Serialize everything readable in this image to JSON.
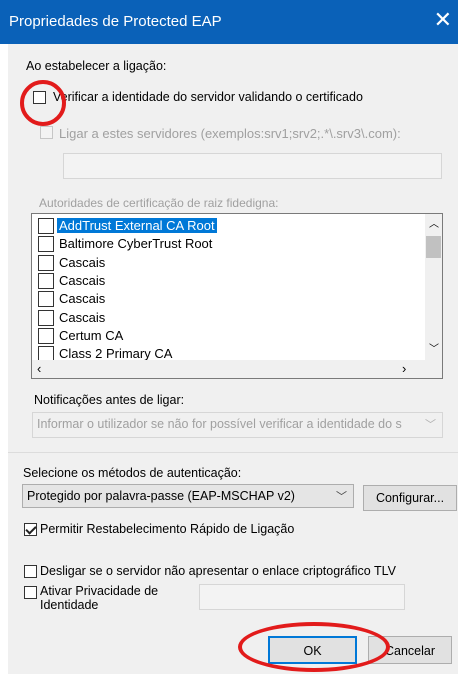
{
  "window": {
    "title": "Propriedades de Protected EAP",
    "close_icon": "close-icon"
  },
  "connect_section": {
    "heading": "Ao estabelecer a ligação:",
    "verify_server_label": "Verificar a identidade do servidor validando o certificado",
    "verify_server_checked": false,
    "connect_servers_label": "Ligar a estes servidores (exemplos:srv1;srv2;.*\\.srv3\\.com):",
    "connect_servers_checked": false,
    "servers_value": ""
  },
  "root_ca": {
    "label": "Autoridades de certificação de raiz fidedigna:",
    "items": [
      {
        "label": "AddTrust External CA Root",
        "checked": false,
        "selected": true
      },
      {
        "label": "Baltimore CyberTrust Root",
        "checked": false,
        "selected": false
      },
      {
        "label": "Cascais",
        "checked": false,
        "selected": false
      },
      {
        "label": "Cascais",
        "checked": false,
        "selected": false
      },
      {
        "label": "Cascais",
        "checked": false,
        "selected": false
      },
      {
        "label": "Cascais",
        "checked": false,
        "selected": false
      },
      {
        "label": "Certum CA",
        "checked": false,
        "selected": false
      },
      {
        "label": "Class 2 Primary CA",
        "checked": false,
        "selected": false
      }
    ]
  },
  "notifications": {
    "label": "Notificações antes de ligar:",
    "selected": "Informar o utilizador se não for possível verificar a identidade do s"
  },
  "auth": {
    "label": "Selecione os métodos de autenticação:",
    "method": "Protegido por palavra-passe (EAP-MSCHAP v2)",
    "configure_label": "Configurar...",
    "fast_reconnect_label": "Permitir Restabelecimento Rápido de Ligação",
    "fast_reconnect_checked": true,
    "disconnect_tlv_label": "Desligar se o servidor não apresentar o enlace criptográfico TLV",
    "disconnect_tlv_checked": false,
    "privacy_label": "Ativar Privacidade de Identidade",
    "privacy_checked": false,
    "privacy_value": ""
  },
  "buttons": {
    "ok": "OK",
    "cancel": "Cancelar"
  },
  "annotation_color": "#e21b1b",
  "accent": "#0078d7"
}
